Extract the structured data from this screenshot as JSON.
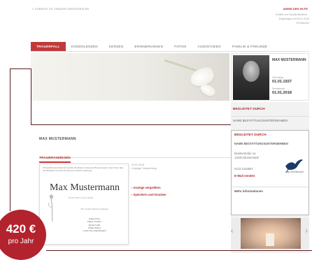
{
  "topbar": {
    "back_link": "< ZURÜCK ZU TRAUER-ANZEIGEN.DE",
    "login": "ANMELDEN HILFE"
  },
  "meta": {
    "line1": "Erstellt von Claudia Musterm...",
    "line2": "Eingetragen am 03.01.2018",
    "line3": "30 Besuche"
  },
  "tabs": [
    {
      "label": "TRAUERFALL",
      "active": true
    },
    {
      "label": "KONDOLENZEN",
      "active": false
    },
    {
      "label": "KERZEN",
      "active": false
    },
    {
      "label": "ERINNERUNGEN",
      "active": false
    },
    {
      "label": "FOTOS",
      "active": false
    },
    {
      "label": "AUDIO/VIDEO",
      "active": false
    },
    {
      "label": "FAMILIE & FREUNDE",
      "active": false
    }
  ],
  "portrait": {
    "name": "MAX MUSTERMANN",
    "born_label": "Geburtstag",
    "born_date": "01.01.1937",
    "died_label": "Sterbedatum",
    "died_date": "01.01.2018"
  },
  "main": {
    "deceased_name": "MAX MUSTERMANN",
    "section_title": "TRAUERANZEIGEN"
  },
  "notice": {
    "intro": "Wir nehmen Abschied und werden ihn immer in unserem Herzen tragen. Unser Vater, Opa und Ehemann verstarb am Tag nach seinem Geburtstag.",
    "name": "Max Mustermann",
    "dates": "*01.01.1937   † 01.01.2018",
    "verse": "Wir werden dich nie vergessen",
    "family": "Deine Frau\nDeine Tochter\nDeine Sohn\nDeine Enkel\nsowie alle Angehörigen",
    "info_date": "22.01.2018",
    "info_source": "Leipziger Volkszeitung",
    "action_view": "› Anzeige vergrößern",
    "action_save": "› Speichern und Drucken"
  },
  "sidebar": {
    "accompanied_head": "BEGLEITET DURCH",
    "accompanied_sub": "NAME BESTATTUNGSUNTERNEHMEN"
  },
  "company": {
    "head": "BEGLEITET DURCH",
    "name": "NAME BESTATTUNGSUNTERNEHMEN",
    "street": "Musterstraße 1a",
    "city": "12345 Musterstadt",
    "phone": "0123 1234567",
    "email": "E-Mail senden",
    "logo_text": "Logo Bestattungen",
    "more": "Mehr informationen"
  },
  "carousel": {
    "prev": "‹",
    "next": "›"
  },
  "price": {
    "amount": "420 €",
    "period": "pro Jahr"
  },
  "colors": {
    "accent": "#c03a3a",
    "price_badge": "#b3232d",
    "connector": "#5a1e1e"
  }
}
